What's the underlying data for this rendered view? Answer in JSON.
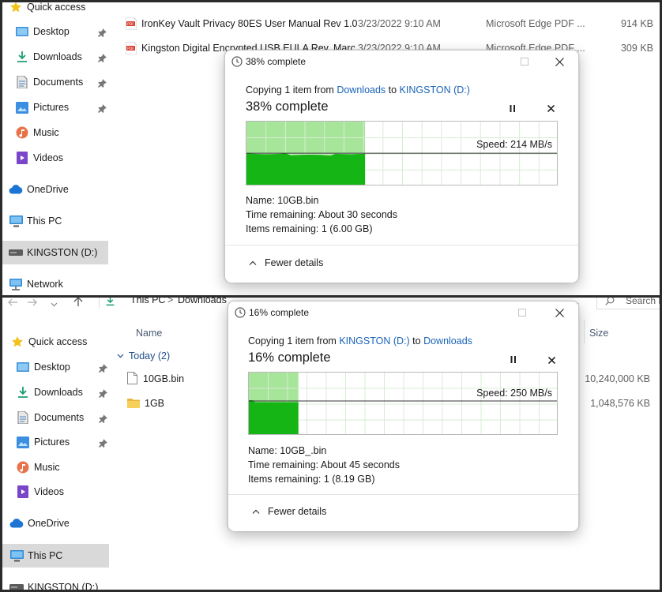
{
  "top": {
    "sidebar": {
      "items": [
        {
          "label": "Quick access",
          "icon": "star-icon"
        },
        {
          "label": "Desktop",
          "icon": "desktop-icon",
          "pinned": true
        },
        {
          "label": "Downloads",
          "icon": "download-icon",
          "pinned": true
        },
        {
          "label": "Documents",
          "icon": "documents-icon",
          "pinned": true
        },
        {
          "label": "Pictures",
          "icon": "pictures-icon",
          "pinned": true
        },
        {
          "label": "Music",
          "icon": "music-icon"
        },
        {
          "label": "Videos",
          "icon": "videos-icon"
        },
        {
          "label": "OneDrive",
          "icon": "cloud-icon"
        },
        {
          "label": "This PC",
          "icon": "computer-icon"
        },
        {
          "label": "KINGSTON (D:)",
          "icon": "drive-icon",
          "selected": true
        },
        {
          "label": "Network",
          "icon": "network-icon"
        }
      ]
    },
    "files": [
      {
        "name": "IronKey Vault Privacy 80ES User Manual Rev 1.0",
        "date": "3/23/2022 9:10 AM",
        "type": "Microsoft Edge PDF ...",
        "size": "914 KB"
      },
      {
        "name": "Kingston Digital Encrypted USB EULA Rev. Marc",
        "date": "3/23/2022 9:10 AM",
        "type": "Microsoft Edge PDF ...",
        "size": "309 KB"
      }
    ],
    "dialog": {
      "title": "38% complete",
      "copy_prefix": "Copying 1 item from ",
      "source": "Downloads",
      "copy_mid": " to ",
      "destination": "KINGSTON (D:)",
      "percent_label": "38% complete",
      "progress": 0.38,
      "speed": "Speed: 214 MB/s",
      "name": "Name:  10GB.bin",
      "time_remaining": "Time remaining:  About 30 seconds",
      "items_remaining": "Items remaining:  1 (6.00 GB)",
      "fewer_details": "Fewer details"
    }
  },
  "bottom": {
    "nav": {
      "breadcrumb_root": "This PC",
      "breadcrumb_sep": ">",
      "breadcrumb_folder": "Downloads",
      "search_placeholder": "Search D"
    },
    "columns": {
      "name": "Name",
      "size": "Size"
    },
    "group": "Today (2)",
    "sidebar": {
      "items": [
        {
          "label": "Quick access",
          "icon": "star-icon"
        },
        {
          "label": "Desktop",
          "icon": "desktop-icon",
          "pinned": true
        },
        {
          "label": "Downloads",
          "icon": "download-icon",
          "pinned": true
        },
        {
          "label": "Documents",
          "icon": "documents-icon",
          "pinned": true
        },
        {
          "label": "Pictures",
          "icon": "pictures-icon",
          "pinned": true
        },
        {
          "label": "Music",
          "icon": "music-icon"
        },
        {
          "label": "Videos",
          "icon": "videos-icon"
        },
        {
          "label": "OneDrive",
          "icon": "cloud-icon"
        },
        {
          "label": "This PC",
          "icon": "computer-icon",
          "selected": true
        },
        {
          "label": "KINGSTON (D:)",
          "icon": "drive-icon"
        }
      ]
    },
    "files": [
      {
        "name": "10GB.bin",
        "size": "10,240,000 KB",
        "icon": "file-icon"
      },
      {
        "name": "1GB",
        "size": "1,048,576 KB",
        "icon": "folder-icon"
      }
    ],
    "dialog": {
      "title": "16% complete",
      "copy_prefix": "Copying 1 item from ",
      "source": "KINGSTON (D:)",
      "copy_mid": " to ",
      "destination": "Downloads",
      "percent_label": "16% complete",
      "progress": 0.16,
      "speed": "Speed: 250 MB/s",
      "name": "Name:  10GB_.bin",
      "time_remaining": "Time remaining:  About 45 seconds",
      "items_remaining": "Items remaining:  1 (8.19 GB)",
      "fewer_details": "Fewer details"
    }
  },
  "colors": {
    "accent": "#1a64b8",
    "progress_fill": "#a6e59a",
    "speed_fill": "#14b514",
    "selected_bg": "#d9d9d9"
  }
}
